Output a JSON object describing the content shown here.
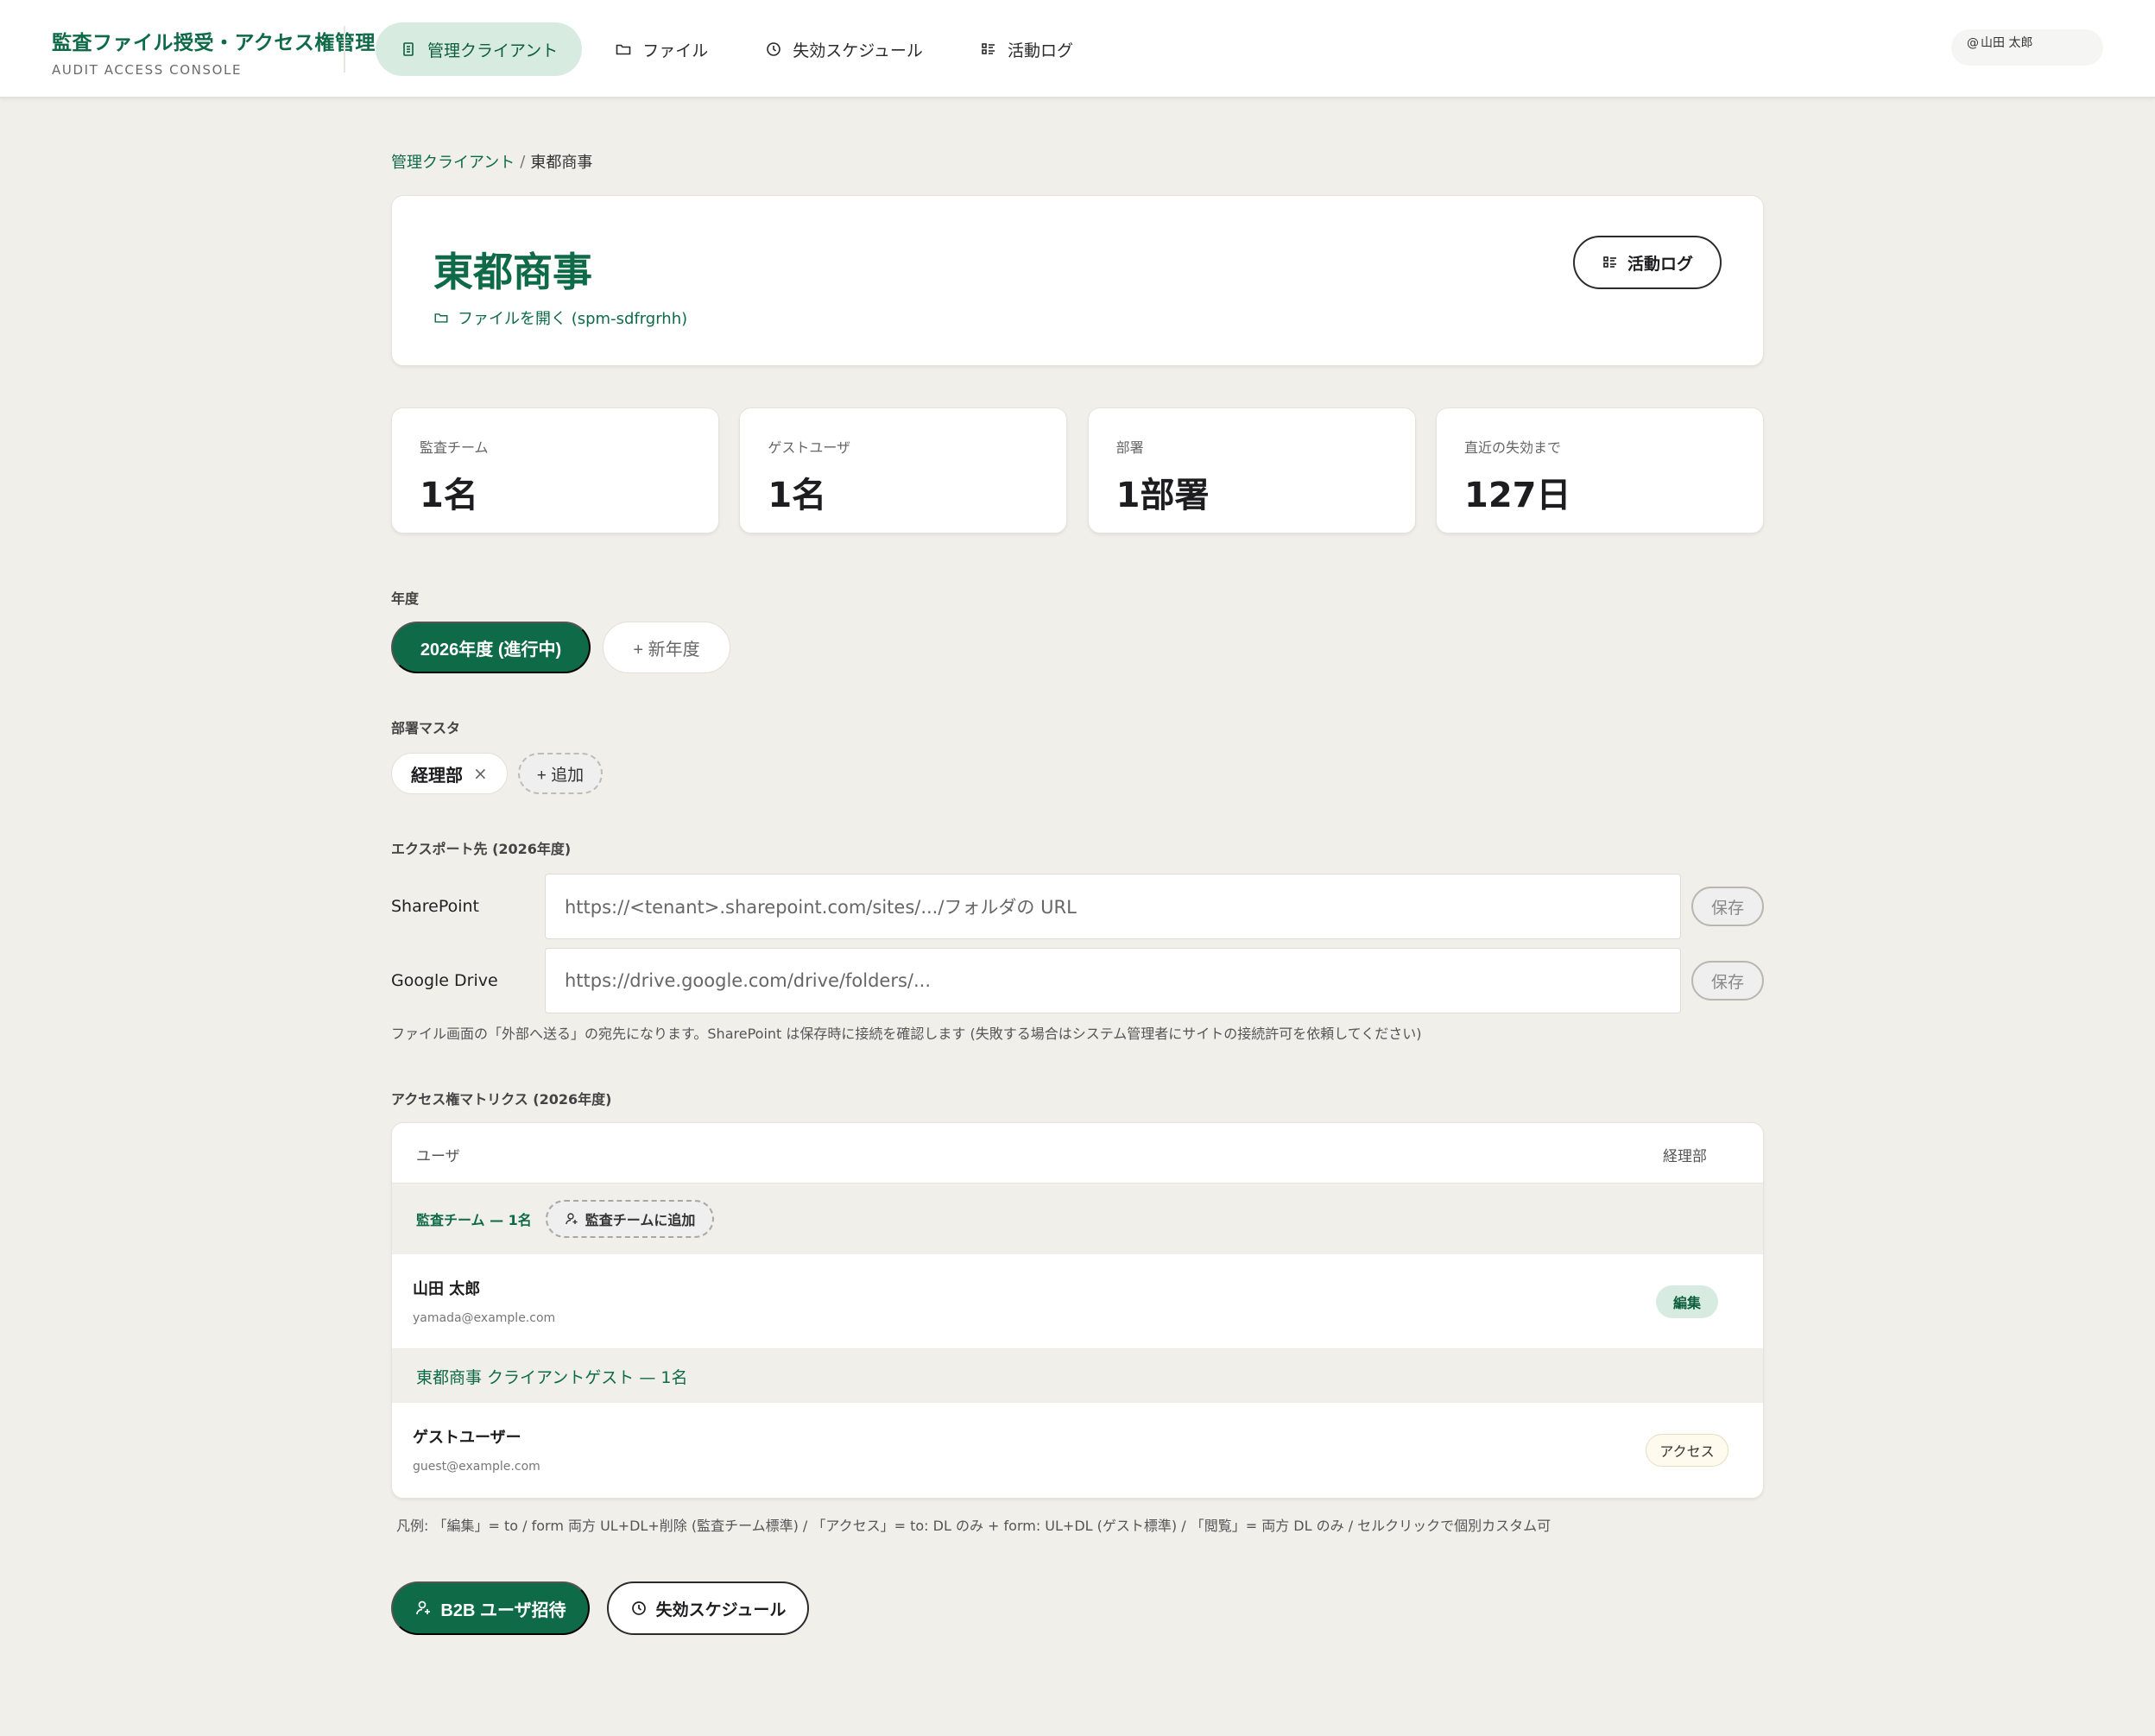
{
  "app": {
    "title": "監査ファイル授受・アクセス権管理",
    "subtitle": "AUDIT ACCESS CONSOLE"
  },
  "nav": {
    "items": [
      {
        "label": "管理クライアント",
        "icon": "building-icon",
        "active": true
      },
      {
        "label": "ファイル",
        "icon": "folder-icon",
        "active": false
      },
      {
        "label": "失効スケジュール",
        "icon": "clock-icon",
        "active": false
      },
      {
        "label": "活動ログ",
        "icon": "list-icon",
        "active": false
      }
    ]
  },
  "user": {
    "at": "@",
    "name": "山田 太郎"
  },
  "breadcrumb": {
    "root": "管理クライアント",
    "sep": "/",
    "current": "東都商事"
  },
  "client": {
    "name": "東都商事",
    "open_files_label": "ファイルを開く (spm-sdfrgrhh)",
    "activity_log_button": "活動ログ"
  },
  "stats": [
    {
      "label": "監査チーム",
      "value": "1名"
    },
    {
      "label": "ゲストユーザ",
      "value": "1名"
    },
    {
      "label": "部署",
      "value": "1部署"
    },
    {
      "label": "直近の失効まで",
      "value": "127日"
    }
  ],
  "fiscal_year": {
    "label": "年度",
    "active": "2026年度 (進行中)",
    "new_button": "+ 新年度"
  },
  "departments": {
    "label": "部署マスタ",
    "items": [
      "経理部"
    ],
    "remove_symbol": "×",
    "add_button": "+ 追加"
  },
  "export": {
    "label": "エクスポート先 (2026年度)",
    "rows": [
      {
        "name": "SharePoint",
        "placeholder": "https://<tenant>.sharepoint.com/sites/.../フォルダの URL",
        "save": "保存"
      },
      {
        "name": "Google Drive",
        "placeholder": "https://drive.google.com/drive/folders/...",
        "save": "保存"
      }
    ],
    "note": "ファイル画面の「外部へ送る」の宛先になります。SharePoint は保存時に接続を確認します (失敗する場合はシステム管理者にサイトの接続許可を依頼してください)"
  },
  "matrix": {
    "label": "アクセス権マトリクス (2026年度)",
    "columns": [
      "ユーザ",
      "経理部"
    ],
    "groups": [
      {
        "title": "監査チーム — 1名",
        "add_button": "監査チームに追加",
        "users": [
          {
            "name": "山田 太郎",
            "email": "yamada@example.com",
            "permission": "編集"
          }
        ]
      },
      {
        "title": "東都商事 クライアントゲスト — 1名",
        "users": [
          {
            "name": "ゲストユーザー",
            "email": "guest@example.com",
            "permission": "アクセス"
          }
        ]
      }
    ],
    "legend": "凡例: 「編集」= to / form 両方 UL+DL+削除 (監査チーム標準) / 「アクセス」= to: DL のみ + form: UL+DL (ゲスト標準) / 「閲覧」= 両方 DL のみ / セルクリックで個別カスタム可"
  },
  "actions": {
    "invite": "B2B ユーザ招待",
    "schedule": "失効スケジュール"
  },
  "colors": {
    "accent": "#0e6a47",
    "accent_light": "#d7ebe1",
    "background": "#f0efea"
  }
}
